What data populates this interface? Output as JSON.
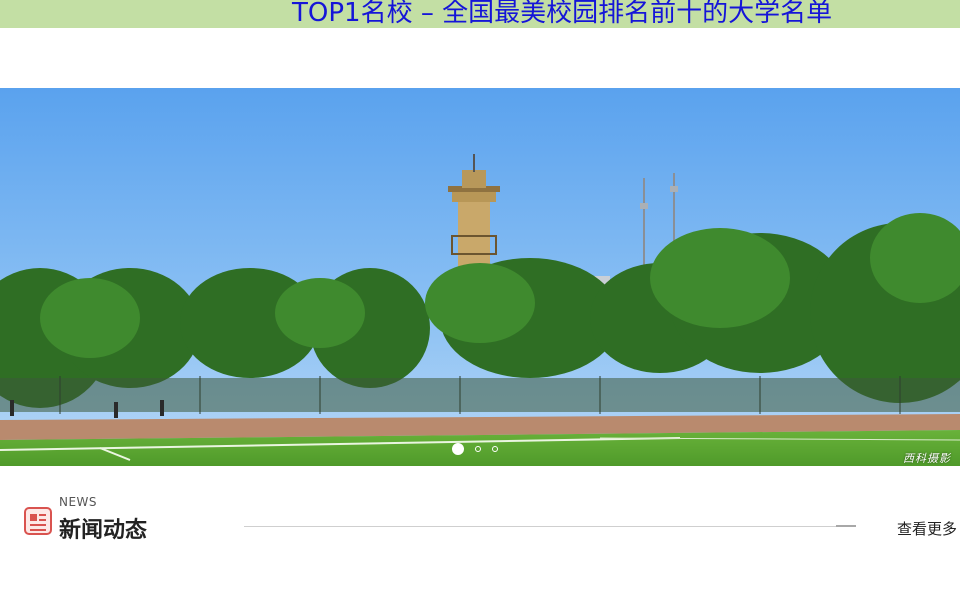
{
  "header": {
    "title": "TOP1名校 – 全国最美校园排名前十的大学名单",
    "background": "#c3dfa4",
    "title_color": "#1515d8"
  },
  "banner": {
    "image": "campus-sports-field-with-water-tower",
    "watermark": "西科摄影",
    "slides": 3,
    "active_slide": 1
  },
  "news": {
    "icon": "newspaper-icon",
    "label_en": "NEWS",
    "label_zh": "新闻动态",
    "more_label": "查看更多",
    "accent": "#d9534f"
  }
}
